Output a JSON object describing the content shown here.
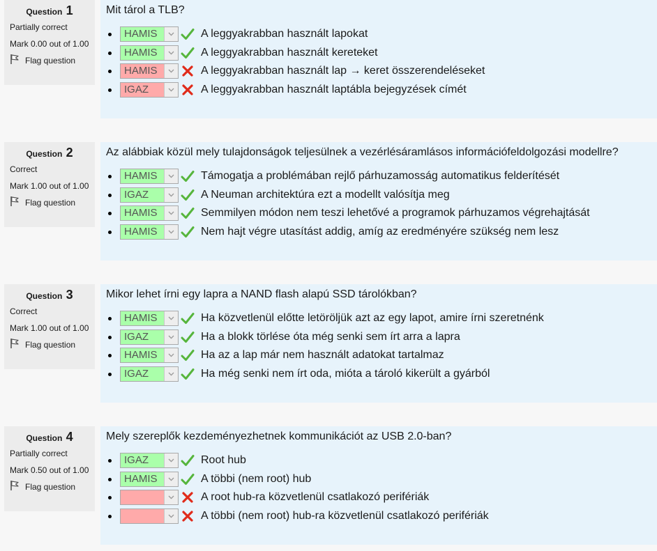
{
  "questions": [
    {
      "label": "Question",
      "number": "1",
      "state": "Partially correct",
      "grade": "Mark 0.00 out of 1.00",
      "flag": "Flag question",
      "text": "Mit tárol a TLB?",
      "answers": [
        {
          "value": "HAMIS",
          "status": "correct",
          "text": "A leggyakrabban használt lapokat"
        },
        {
          "value": "HAMIS",
          "status": "correct",
          "text": "A leggyakrabban használt kereteket"
        },
        {
          "value": "HAMIS",
          "status": "incorrect",
          "text": "A leggyakrabban használt lap → keret összerendeléseket"
        },
        {
          "value": "IGAZ",
          "status": "incorrect",
          "text": "A leggyakrabban használt laptábla bejegyzések címét"
        }
      ]
    },
    {
      "label": "Question",
      "number": "2",
      "state": "Correct",
      "grade": "Mark 1.00 out of 1.00",
      "flag": "Flag question",
      "text": "Az alábbiak közül mely tulajdonságok teljesülnek a vezérlésáramlásos információfeldolgozási modellre?",
      "answers": [
        {
          "value": "HAMIS",
          "status": "correct",
          "text": "Támogatja a problémában rejlő párhuzamosság automatikus felderítését"
        },
        {
          "value": "IGAZ",
          "status": "correct",
          "text": "A Neuman architektúra ezt a modellt valósítja meg"
        },
        {
          "value": "HAMIS",
          "status": "correct",
          "text": "Semmilyen módon nem teszi lehetővé a programok párhuzamos végrehajtását"
        },
        {
          "value": "HAMIS",
          "status": "correct",
          "text": "Nem hajt végre utasítást addig, amíg az eredményére szükség nem lesz"
        }
      ]
    },
    {
      "label": "Question",
      "number": "3",
      "state": "Correct",
      "grade": "Mark 1.00 out of 1.00",
      "flag": "Flag question",
      "text": "Mikor lehet írni egy lapra a NAND flash alapú SSD tárolókban?",
      "answers": [
        {
          "value": "HAMIS",
          "status": "correct",
          "text": "Ha közvetlenül előtte letöröljük azt az egy lapot, amire írni szeretnénk"
        },
        {
          "value": "IGAZ",
          "status": "correct",
          "text": "Ha a blokk törlése óta még senki sem írt arra a lapra"
        },
        {
          "value": "HAMIS",
          "status": "correct",
          "text": "Ha az a lap már nem használt adatokat tartalmaz"
        },
        {
          "value": "IGAZ",
          "status": "correct",
          "text": "Ha még senki nem írt oda, mióta a tároló kikerült a gyárból"
        }
      ]
    },
    {
      "label": "Question",
      "number": "4",
      "state": "Partially correct",
      "grade": "Mark 0.50 out of 1.00",
      "flag": "Flag question",
      "text": "Mely szereplők kezdeményezhetnek kommunikációt az USB 2.0-ban?",
      "answers": [
        {
          "value": "IGAZ",
          "status": "correct",
          "text": "Root hub"
        },
        {
          "value": "HAMIS",
          "status": "correct",
          "text": "A többi (nem root) hub"
        },
        {
          "value": "",
          "status": "incorrect",
          "text": "A root hub-ra közvetlenül csatlakozó perifériák"
        },
        {
          "value": "",
          "status": "incorrect",
          "text": "A többi (nem root) hub-ra közvetlenül csatlakozó perifériák"
        }
      ]
    }
  ],
  "colors": {
    "correct_bg": "#aaffaa",
    "incorrect_bg": "#ffaaaa",
    "check": "#56b53c",
    "cross": "#e02b1a",
    "content_bg": "#e7f3fb",
    "info_bg": "#ececec"
  },
  "icons": {
    "flag": "flag-icon",
    "correct": "check-icon",
    "incorrect": "cross-icon",
    "dropdown": "chevron-down-icon"
  }
}
